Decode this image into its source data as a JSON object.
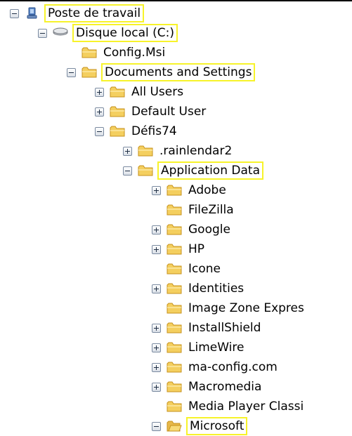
{
  "tree": {
    "items": [
      {
        "label": "Poste de travail",
        "expander": "expanded",
        "icon": "computer-icon",
        "highlighted": true
      },
      {
        "label": "Disque local (C:)",
        "expander": "expanded",
        "icon": "drive-icon",
        "highlighted": true
      },
      {
        "label": "Config.Msi",
        "expander": "none",
        "icon": "folder-icon",
        "highlighted": false
      },
      {
        "label": "Documents and Settings",
        "expander": "expanded",
        "icon": "folder-icon",
        "highlighted": true
      },
      {
        "label": "All Users",
        "expander": "collapsed",
        "icon": "folder-icon",
        "highlighted": false
      },
      {
        "label": "Default User",
        "expander": "collapsed",
        "icon": "folder-icon",
        "highlighted": false
      },
      {
        "label": "Défis74",
        "expander": "expanded",
        "icon": "folder-icon",
        "highlighted": false
      },
      {
        "label": ".rainlendar2",
        "expander": "collapsed",
        "icon": "folder-icon",
        "highlighted": false
      },
      {
        "label": "Application Data",
        "expander": "expanded",
        "icon": "folder-icon",
        "highlighted": true
      },
      {
        "label": "Adobe",
        "expander": "collapsed",
        "icon": "folder-icon",
        "highlighted": false
      },
      {
        "label": "FileZilla",
        "expander": "none",
        "icon": "folder-icon",
        "highlighted": false
      },
      {
        "label": "Google",
        "expander": "collapsed",
        "icon": "folder-icon",
        "highlighted": false
      },
      {
        "label": "HP",
        "expander": "collapsed",
        "icon": "folder-icon",
        "highlighted": false
      },
      {
        "label": "Icone",
        "expander": "none",
        "icon": "folder-icon",
        "highlighted": false
      },
      {
        "label": "Identities",
        "expander": "collapsed",
        "icon": "folder-icon",
        "highlighted": false
      },
      {
        "label": "Image Zone Expres",
        "expander": "none",
        "icon": "folder-icon",
        "highlighted": false
      },
      {
        "label": "InstallShield",
        "expander": "collapsed",
        "icon": "folder-icon",
        "highlighted": false
      },
      {
        "label": "LimeWire",
        "expander": "collapsed",
        "icon": "folder-icon",
        "highlighted": false
      },
      {
        "label": "ma-config.com",
        "expander": "collapsed",
        "icon": "folder-icon",
        "highlighted": false
      },
      {
        "label": "Macromedia",
        "expander": "collapsed",
        "icon": "folder-icon",
        "highlighted": false
      },
      {
        "label": "Media Player Classi",
        "expander": "none",
        "icon": "folder-icon",
        "highlighted": false
      },
      {
        "label": "Microsoft",
        "expander": "expanded",
        "icon": "folder-icon",
        "highlighted": true
      }
    ]
  }
}
